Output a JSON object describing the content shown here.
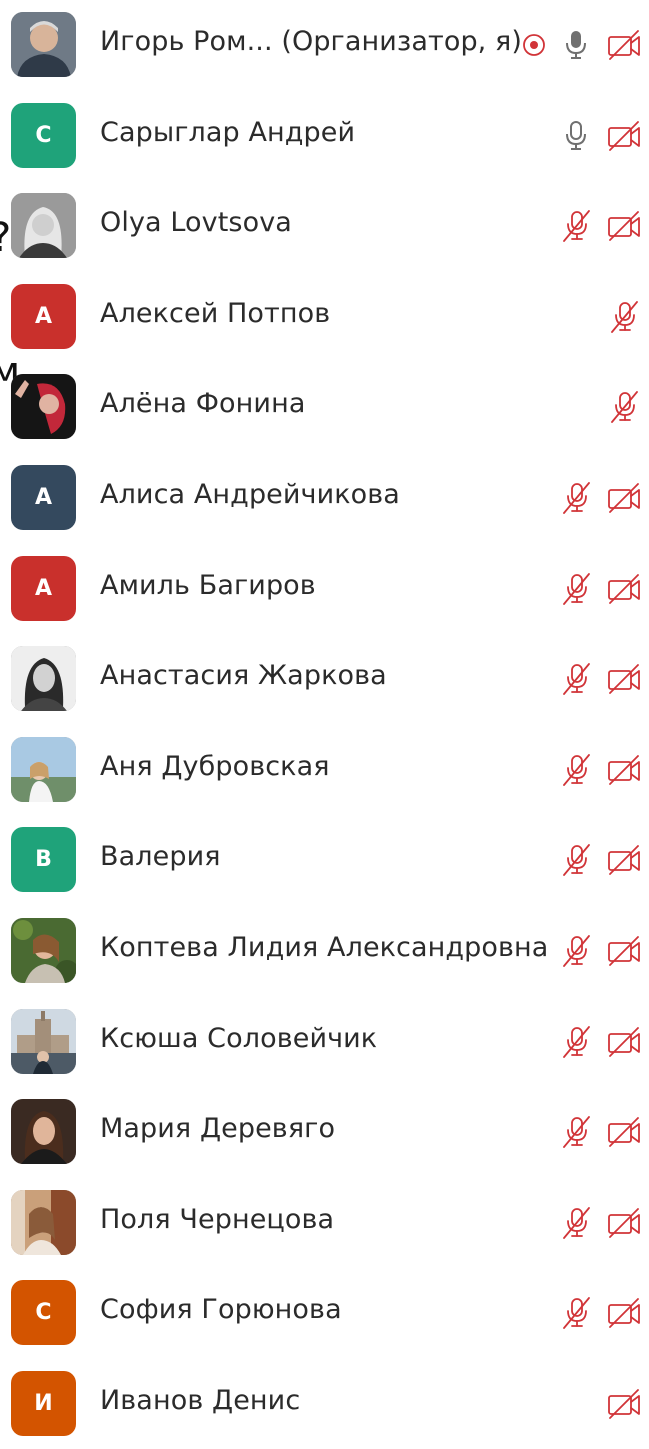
{
  "edge_text": {
    "q": "?",
    "m": "м"
  },
  "colors": {
    "muted_red": "#d13438",
    "teal": "#1fa37a",
    "red": "#c9302c",
    "navy": "#34495e",
    "orange": "#d35400"
  },
  "participants": [
    {
      "name": "Игорь Ром... (Организатор, я)",
      "avatar_type": "photo",
      "photo": "gray-suit",
      "initial": "",
      "recording": true,
      "mic": "on",
      "camera": "off"
    },
    {
      "name": "Сарыглар Андрей",
      "avatar_type": "initial",
      "initial": "С",
      "color": "teal",
      "mic": "on-outline",
      "camera": "off"
    },
    {
      "name": "Olya Lovtsova",
      "avatar_type": "photo",
      "photo": "bw-blonde",
      "initial": "",
      "mic": "off",
      "camera": "off"
    },
    {
      "name": "Алексей Потпов",
      "avatar_type": "initial",
      "initial": "А",
      "color": "red",
      "mic": "off",
      "camera": "none"
    },
    {
      "name": "Алёна Фонина",
      "avatar_type": "photo",
      "photo": "red-hair",
      "initial": "",
      "mic": "off",
      "camera": "none"
    },
    {
      "name": "Алиса Андрейчикова",
      "avatar_type": "initial",
      "initial": "А",
      "color": "navy",
      "mic": "off",
      "camera": "off"
    },
    {
      "name": "Амиль Багиров",
      "avatar_type": "initial",
      "initial": "А",
      "color": "red",
      "mic": "off",
      "camera": "off"
    },
    {
      "name": "Анастасия Жаркова",
      "avatar_type": "photo",
      "photo": "bw-portrait",
      "initial": "",
      "mic": "off",
      "camera": "off"
    },
    {
      "name": "Аня Дубровская",
      "avatar_type": "photo",
      "photo": "outdoor-sky",
      "initial": "",
      "mic": "off",
      "camera": "off"
    },
    {
      "name": "Валерия",
      "avatar_type": "initial",
      "initial": "В",
      "color": "teal",
      "mic": "off",
      "camera": "off"
    },
    {
      "name": "Коптева Лидия Александровна",
      "avatar_type": "photo",
      "photo": "green-leaves",
      "initial": "",
      "mic": "off",
      "camera": "off"
    },
    {
      "name": "Ксюша Соловейчик",
      "avatar_type": "photo",
      "photo": "city-building",
      "initial": "",
      "mic": "off",
      "camera": "off"
    },
    {
      "name": "Мария Деревяго",
      "avatar_type": "photo",
      "photo": "dark-brown",
      "initial": "",
      "mic": "off",
      "camera": "off"
    },
    {
      "name": "Поля Чернецова",
      "avatar_type": "photo",
      "photo": "warm-room",
      "initial": "",
      "mic": "off",
      "camera": "off"
    },
    {
      "name": "София Горюнова",
      "avatar_type": "initial",
      "initial": "С",
      "color": "orange",
      "mic": "off",
      "camera": "off"
    },
    {
      "name": "Иванов Денис",
      "avatar_type": "initial",
      "initial": "И",
      "color": "orange",
      "mic": "none",
      "camera": "off"
    }
  ]
}
